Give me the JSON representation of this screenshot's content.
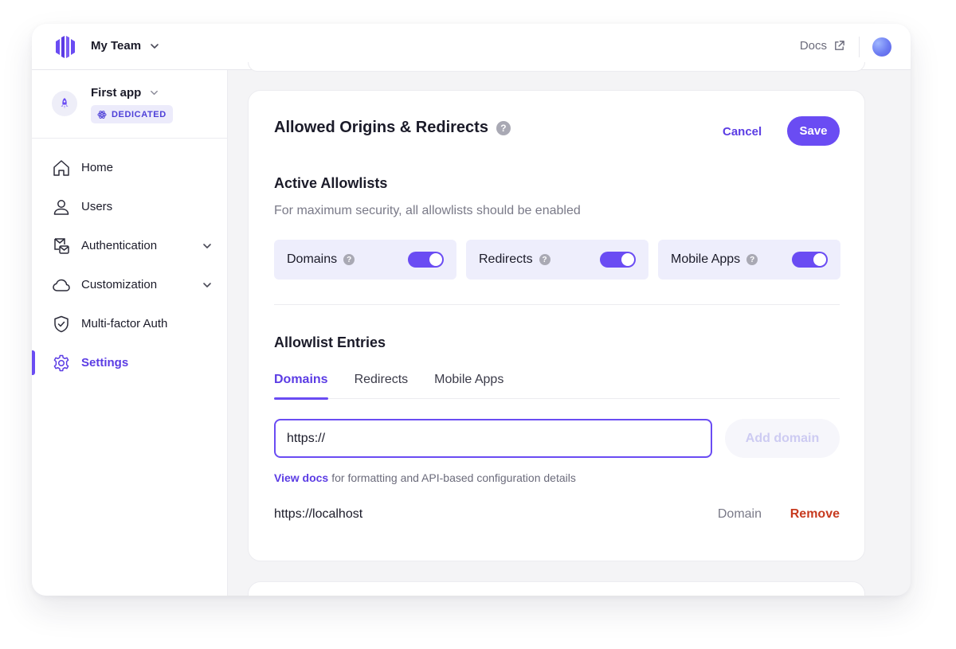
{
  "topbar": {
    "team_name": "My Team",
    "docs_label": "Docs"
  },
  "sidebar": {
    "app_name": "First app",
    "app_badge": "DEDICATED",
    "items": [
      {
        "label": "Home",
        "icon": "home-icon"
      },
      {
        "label": "Users",
        "icon": "user-icon"
      },
      {
        "label": "Authentication",
        "icon": "auth-icon",
        "expandable": true
      },
      {
        "label": "Customization",
        "icon": "cloud-icon",
        "expandable": true
      },
      {
        "label": "Multi-factor Auth",
        "icon": "shield-icon"
      },
      {
        "label": "Settings",
        "icon": "gear-icon",
        "active": true
      }
    ]
  },
  "card": {
    "title": "Allowed Origins & Redirects",
    "cancel_label": "Cancel",
    "save_label": "Save",
    "active_title": "Active Allowlists",
    "active_hint": "For maximum security, all allowlists should be enabled",
    "toggles": [
      {
        "label": "Domains",
        "enabled": true
      },
      {
        "label": "Redirects",
        "enabled": true
      },
      {
        "label": "Mobile Apps",
        "enabled": true
      }
    ],
    "entries_title": "Allowlist Entries",
    "tabs": [
      {
        "label": "Domains",
        "active": true
      },
      {
        "label": "Redirects"
      },
      {
        "label": "Mobile Apps"
      }
    ],
    "input_value": "https://",
    "add_label": "Add domain",
    "docs_link": "View docs",
    "docs_text": "for formatting and API-based configuration details",
    "entries": [
      {
        "value": "https://localhost",
        "type": "Domain",
        "action": "Remove"
      }
    ]
  },
  "colors": {
    "accent": "#6a4cf3",
    "danger": "#c73a1f",
    "toggle_bg": "#eeeefc"
  }
}
